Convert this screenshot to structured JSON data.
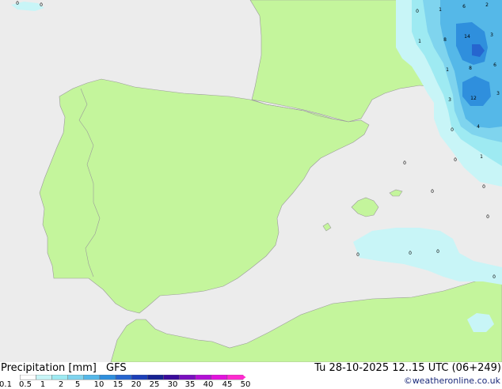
{
  "footer": {
    "product": "Precipitation [mm]",
    "model": "GFS",
    "valid_time": "Tu 28-10-2025 12..15 UTC (06+249)",
    "credit": "©weatheronline.co.uk"
  },
  "legend": {
    "labels": [
      "0.1",
      "0.5",
      "1",
      "2",
      "5",
      "10",
      "15",
      "20",
      "25",
      "30",
      "35",
      "40",
      "45",
      "50"
    ],
    "colors": [
      "#ffffff",
      "#c8f5f7",
      "#9eeaf2",
      "#7fd4ee",
      "#55b8e8",
      "#2f8fdd",
      "#2665cf",
      "#1c3fb8",
      "#162292",
      "#3a0b9a",
      "#7a0fbf",
      "#b310d6",
      "#e213dc",
      "#ff2bd0"
    ]
  },
  "map_numbers": [
    {
      "text": "0",
      "name": "value-label"
    },
    {
      "text": "0",
      "name": "value-label"
    },
    {
      "text": "0",
      "name": "value-label"
    },
    {
      "text": "1",
      "name": "value-label"
    },
    {
      "text": "6",
      "name": "value-label"
    },
    {
      "text": "2",
      "name": "value-label"
    },
    {
      "text": "1",
      "name": "value-label"
    },
    {
      "text": "8",
      "name": "value-label"
    },
    {
      "text": "14",
      "name": "value-label"
    },
    {
      "text": "3",
      "name": "value-label"
    },
    {
      "text": "1",
      "name": "value-label"
    },
    {
      "text": "8",
      "name": "value-label"
    },
    {
      "text": "6",
      "name": "value-label"
    },
    {
      "text": "3",
      "name": "value-label"
    },
    {
      "text": "12",
      "name": "value-label"
    },
    {
      "text": "3",
      "name": "value-label"
    },
    {
      "text": "0",
      "name": "value-label"
    },
    {
      "text": "4",
      "name": "value-label"
    },
    {
      "text": "0",
      "name": "value-label"
    },
    {
      "text": "0",
      "name": "value-label"
    },
    {
      "text": "1",
      "name": "value-label"
    },
    {
      "text": "0",
      "name": "value-label"
    },
    {
      "text": "0",
      "name": "value-label"
    },
    {
      "text": "0",
      "name": "value-label"
    },
    {
      "text": "0",
      "name": "value-label"
    },
    {
      "text": "0",
      "name": "value-label"
    },
    {
      "text": "0",
      "name": "value-label"
    },
    {
      "text": "0",
      "name": "value-label"
    }
  ]
}
